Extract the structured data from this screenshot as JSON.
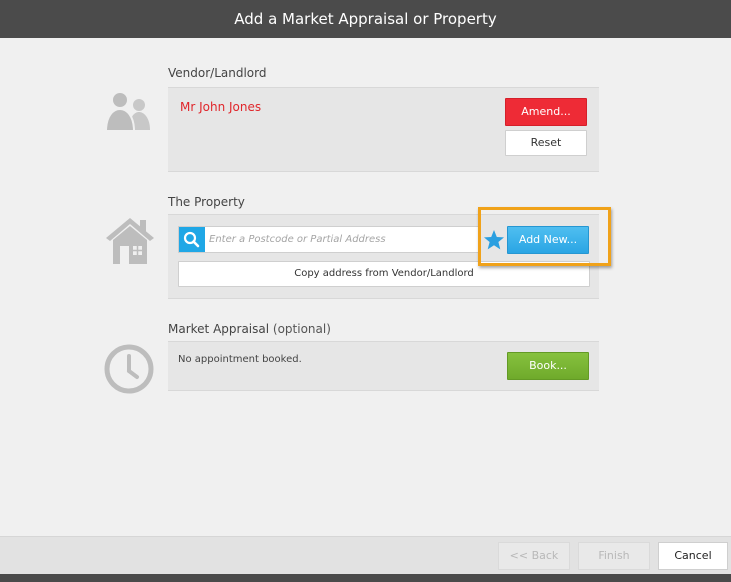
{
  "window": {
    "title": "Add a Market Appraisal or Property"
  },
  "vendor": {
    "section_label": "Vendor/Landlord",
    "name": "Mr John Jones",
    "amend_label": "Amend...",
    "reset_label": "Reset"
  },
  "property": {
    "section_label": "The Property",
    "search_placeholder": "Enter a Postcode or Partial Address",
    "add_new_label": "Add New...",
    "copy_address_label": "Copy address from Vendor/Landlord"
  },
  "appraisal": {
    "section_label": "Market Appraisal",
    "optional_label": "(optional)",
    "status": "No appointment booked.",
    "book_label": "Book..."
  },
  "footer": {
    "back_label": "<< Back",
    "finish_label": "Finish",
    "cancel_label": "Cancel"
  },
  "colors": {
    "accent_blue": "#1fa7e6",
    "amend_red": "#ee2b36",
    "book_green": "#78b334",
    "highlight_orange": "#f0a21a",
    "vendor_name_red": "#e0262b"
  },
  "icons": {
    "vendor": "users-icon",
    "property": "house-icon",
    "appraisal": "clock-icon",
    "search": "search-icon",
    "favourite": "star-icon"
  }
}
